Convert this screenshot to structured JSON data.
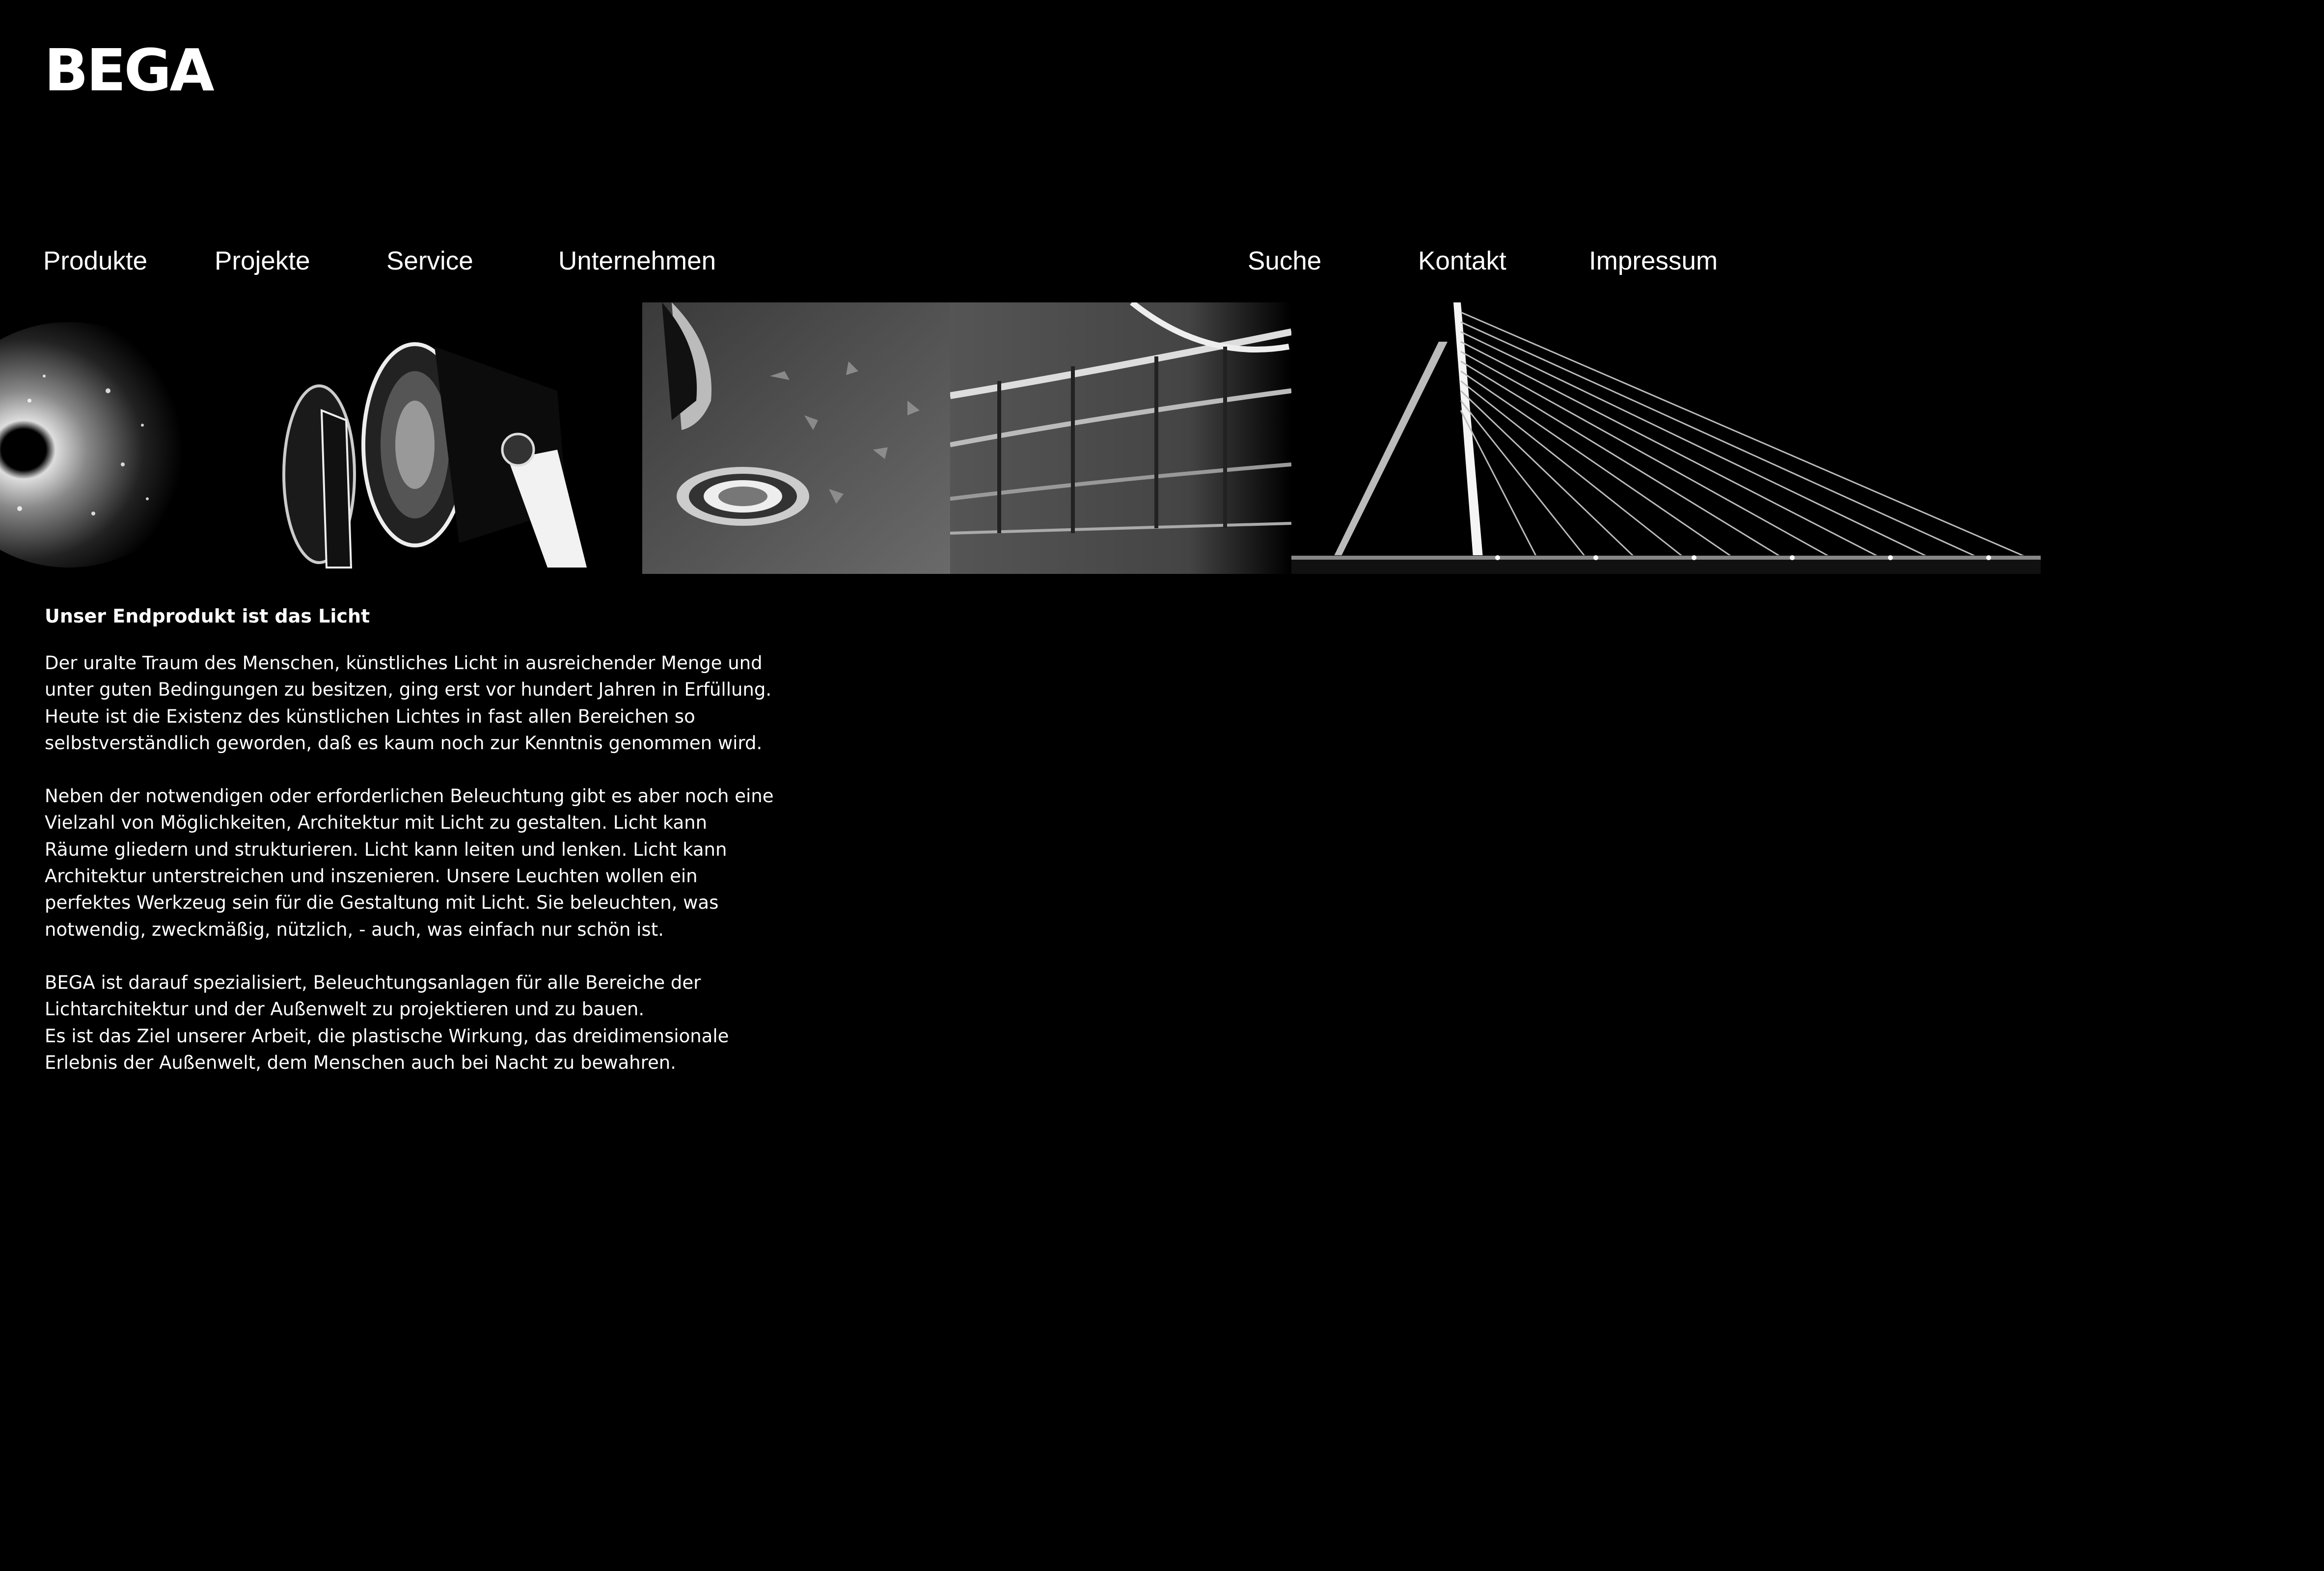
{
  "brand": {
    "logo_text": "BEGA"
  },
  "nav": {
    "left": [
      {
        "label": "Produkte"
      },
      {
        "label": "Projekte"
      },
      {
        "label": "Service"
      },
      {
        "label": "Unternehmen"
      }
    ],
    "right": [
      {
        "label": "Suche"
      },
      {
        "label": "Kontakt"
      },
      {
        "label": "Impressum"
      }
    ]
  },
  "banner": {
    "images": [
      {
        "icon": "light-burst-image"
      },
      {
        "icon": "spotlight-fixtures-image"
      },
      {
        "icon": "ground-light-image"
      },
      {
        "icon": "curved-building-image"
      },
      {
        "icon": "cable-bridge-image"
      }
    ]
  },
  "content": {
    "headline": "Unser Endprodukt ist das Licht",
    "paragraphs": [
      "Der uralte Traum des Menschen, künstliches Licht in ausreichender Menge und\nunter guten Bedingungen zu besitzen, ging erst vor hundert Jahren in Erfüllung.\nHeute ist die Existenz des künstlichen Lichtes in fast allen Bereichen so\nselbstverständlich geworden, daß es kaum noch zur Kenntnis genommen wird.",
      "Neben der notwendigen oder erforderlichen Beleuchtung gibt es aber noch eine\nVielzahl von Möglichkeiten, Architektur mit Licht zu gestalten. Licht kann\nRäume gliedern und strukturieren. Licht kann leiten und lenken. Licht kann\nArchitektur unterstreichen und inszenieren. Unsere Leuchten wollen ein\nperfektes Werkzeug sein für die Gestaltung mit Licht. Sie beleuchten, was\nnotwendig, zweckmäßig, nützlich, - auch, was einfach nur schön ist.",
      "BEGA ist darauf spezialisiert, Beleuchtungsanlagen für alle Bereiche der\nLichtarchitektur und der Außenwelt zu projektieren und zu bauen.\nEs ist das Ziel unserer Arbeit, die plastische Wirkung, das dreidimensionale\nErlebnis der Außenwelt, dem Menschen auch bei Nacht zu bewahren."
    ]
  },
  "colors": {
    "background": "#000000",
    "text": "#ffffff"
  }
}
